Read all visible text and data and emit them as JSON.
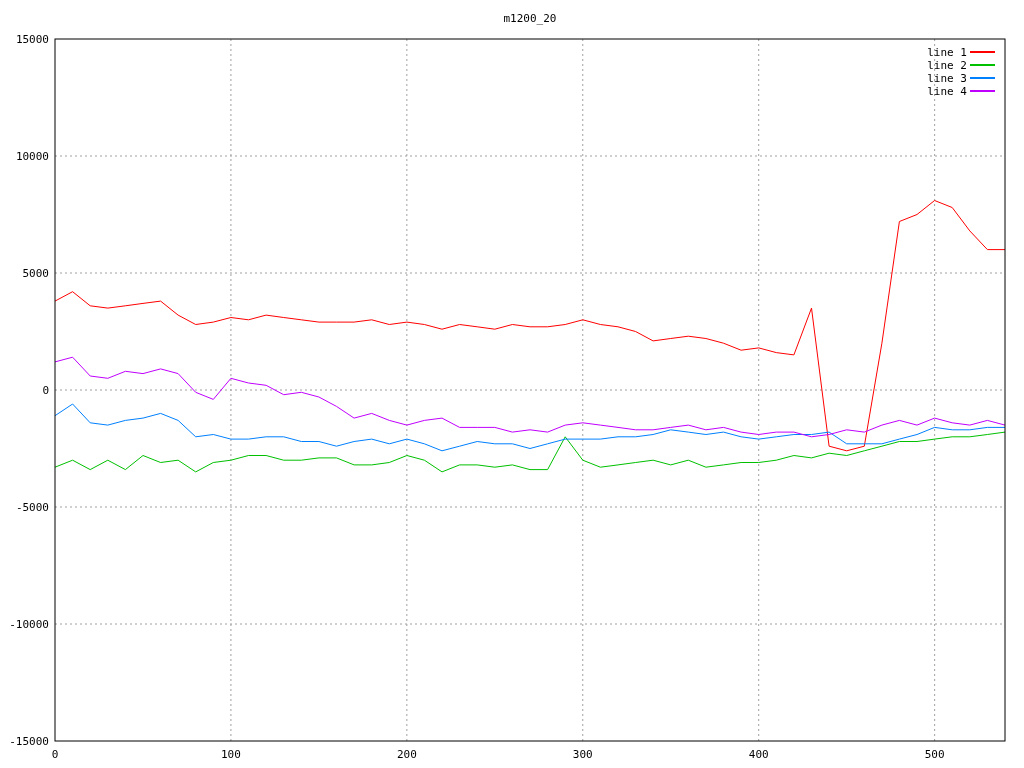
{
  "chart_data": {
    "type": "line",
    "title": "m1200_20",
    "grid": true,
    "legend": true,
    "x": [
      0,
      10,
      20,
      30,
      40,
      50,
      60,
      70,
      80,
      90,
      100,
      110,
      120,
      130,
      140,
      150,
      160,
      170,
      180,
      190,
      200,
      210,
      220,
      230,
      240,
      250,
      260,
      270,
      280,
      290,
      300,
      310,
      320,
      330,
      340,
      350,
      360,
      370,
      380,
      390,
      400,
      410,
      420,
      430,
      440,
      450,
      460,
      470,
      480,
      490,
      500,
      510,
      520,
      530,
      540
    ],
    "xlim": [
      0,
      540
    ],
    "ylim": [
      -15000,
      15000
    ],
    "xticks": [
      0,
      100,
      200,
      300,
      400,
      500
    ],
    "yticks": [
      -15000,
      -10000,
      -5000,
      0,
      5000,
      10000,
      15000
    ],
    "series": [
      {
        "name": "line 1",
        "color": "#ff0000",
        "values": [
          3800,
          4200,
          3600,
          3500,
          3600,
          3700,
          3800,
          3200,
          2800,
          2900,
          3100,
          3000,
          3200,
          3100,
          3000,
          2900,
          2900,
          2900,
          3000,
          2800,
          2900,
          2800,
          2600,
          2800,
          2700,
          2600,
          2800,
          2700,
          2700,
          2800,
          3000,
          2800,
          2700,
          2500,
          2100,
          2200,
          2300,
          2200,
          2000,
          1700,
          1800,
          1600,
          1500,
          3500,
          -2400,
          -2600,
          -2400,
          2000,
          7200,
          7500,
          8100,
          7800,
          6800,
          6000,
          6000
        ]
      },
      {
        "name": "line 2",
        "color": "#00c000",
        "values": [
          -3300,
          -3000,
          -3400,
          -3000,
          -3400,
          -2800,
          -3100,
          -3000,
          -3500,
          -3100,
          -3000,
          -2800,
          -2800,
          -3000,
          -3000,
          -2900,
          -2900,
          -3200,
          -3200,
          -3100,
          -2800,
          -3000,
          -3500,
          -3200,
          -3200,
          -3300,
          -3200,
          -3400,
          -3400,
          -2000,
          -3000,
          -3300,
          -3200,
          -3100,
          -3000,
          -3200,
          -3000,
          -3300,
          -3200,
          -3100,
          -3100,
          -3000,
          -2800,
          -2900,
          -2700,
          -2800,
          -2600,
          -2400,
          -2200,
          -2200,
          -2100,
          -2000,
          -2000,
          -1900,
          -1800
        ]
      },
      {
        "name": "line 3",
        "color": "#0080ff",
        "values": [
          -1100,
          -600,
          -1400,
          -1500,
          -1300,
          -1200,
          -1000,
          -1300,
          -2000,
          -1900,
          -2100,
          -2100,
          -2000,
          -2000,
          -2200,
          -2200,
          -2400,
          -2200,
          -2100,
          -2300,
          -2100,
          -2300,
          -2600,
          -2400,
          -2200,
          -2300,
          -2300,
          -2500,
          -2300,
          -2100,
          -2100,
          -2100,
          -2000,
          -2000,
          -1900,
          -1700,
          -1800,
          -1900,
          -1800,
          -2000,
          -2100,
          -2000,
          -1900,
          -1900,
          -1800,
          -2300,
          -2300,
          -2300,
          -2100,
          -1900,
          -1600,
          -1700,
          -1700,
          -1600,
          -1600
        ]
      },
      {
        "name": "line 4",
        "color": "#c000ff",
        "values": [
          1200,
          1400,
          600,
          500,
          800,
          700,
          900,
          700,
          -100,
          -400,
          500,
          300,
          200,
          -200,
          -100,
          -300,
          -700,
          -1200,
          -1000,
          -1300,
          -1500,
          -1300,
          -1200,
          -1600,
          -1600,
          -1600,
          -1800,
          -1700,
          -1800,
          -1500,
          -1400,
          -1500,
          -1600,
          -1700,
          -1700,
          -1600,
          -1500,
          -1700,
          -1600,
          -1800,
          -1900,
          -1800,
          -1800,
          -2000,
          -1900,
          -1700,
          -1800,
          -1500,
          -1300,
          -1500,
          -1200,
          -1400,
          -1500,
          -1300,
          -1500
        ]
      }
    ]
  }
}
